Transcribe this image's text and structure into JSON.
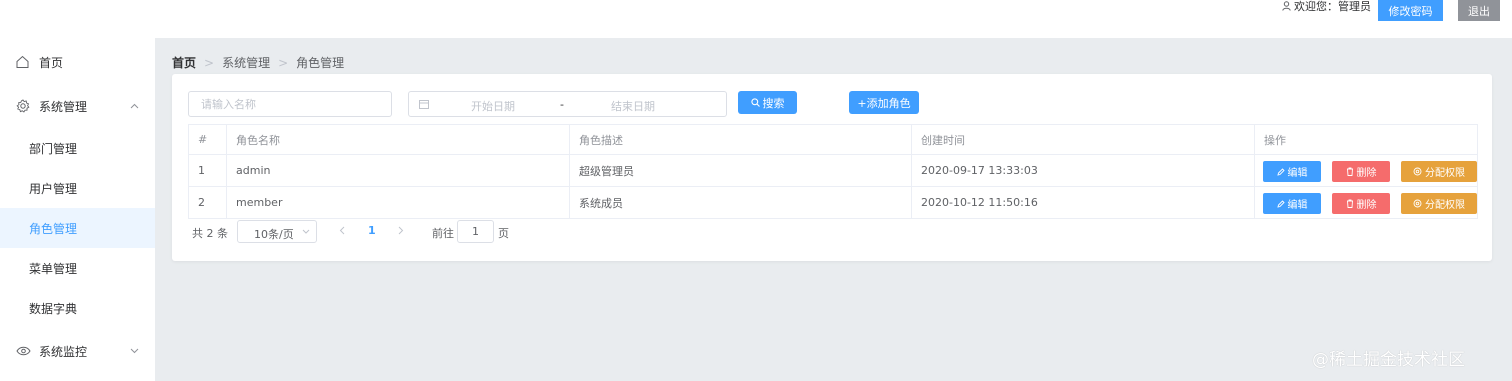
{
  "header": {
    "welcome": "欢迎您：管理员",
    "change_password": "修改密码",
    "logout": "退出"
  },
  "sidebar": {
    "items": [
      {
        "label": "首页",
        "icon": "home-icon"
      },
      {
        "label": "系统管理",
        "icon": "gear-icon",
        "expanded": true,
        "children": [
          "部门管理",
          "用户管理",
          "角色管理",
          "菜单管理",
          "数据字典"
        ],
        "active": "角色管理"
      },
      {
        "label": "系统监控",
        "icon": "eye-icon",
        "expanded": false
      }
    ]
  },
  "breadcrumb": [
    "首页",
    "系统管理",
    "角色管理"
  ],
  "toolbar": {
    "name_placeholder": "请输入名称",
    "start_placeholder": "开始日期",
    "range_separator": "-",
    "end_placeholder": "结束日期",
    "search_label": "搜索",
    "add_label": "+添加角色"
  },
  "table": {
    "columns": [
      "#",
      "角色名称",
      "角色描述",
      "创建时间",
      "操作"
    ],
    "rows": [
      {
        "index": "1",
        "name": "admin",
        "desc": "超级管理员",
        "created": "2020-09-17 13:33:03"
      },
      {
        "index": "2",
        "name": "member",
        "desc": "系统成员",
        "created": "2020-10-12 11:50:16"
      }
    ],
    "actions": {
      "edit": "编辑",
      "delete": "删除",
      "permission": "分配权限"
    }
  },
  "pagination": {
    "total": "共 2 条",
    "page_size": "10条/页",
    "current": "1",
    "goto_label": "前往",
    "goto_value": "1",
    "page_suffix": "页"
  },
  "colors": {
    "primary": "#409eff",
    "danger": "#f56c6c",
    "warning": "#e6a23c",
    "info": "#909399",
    "active_bg": "#ecf5ff"
  },
  "watermark": "@稀土掘金技术社区"
}
